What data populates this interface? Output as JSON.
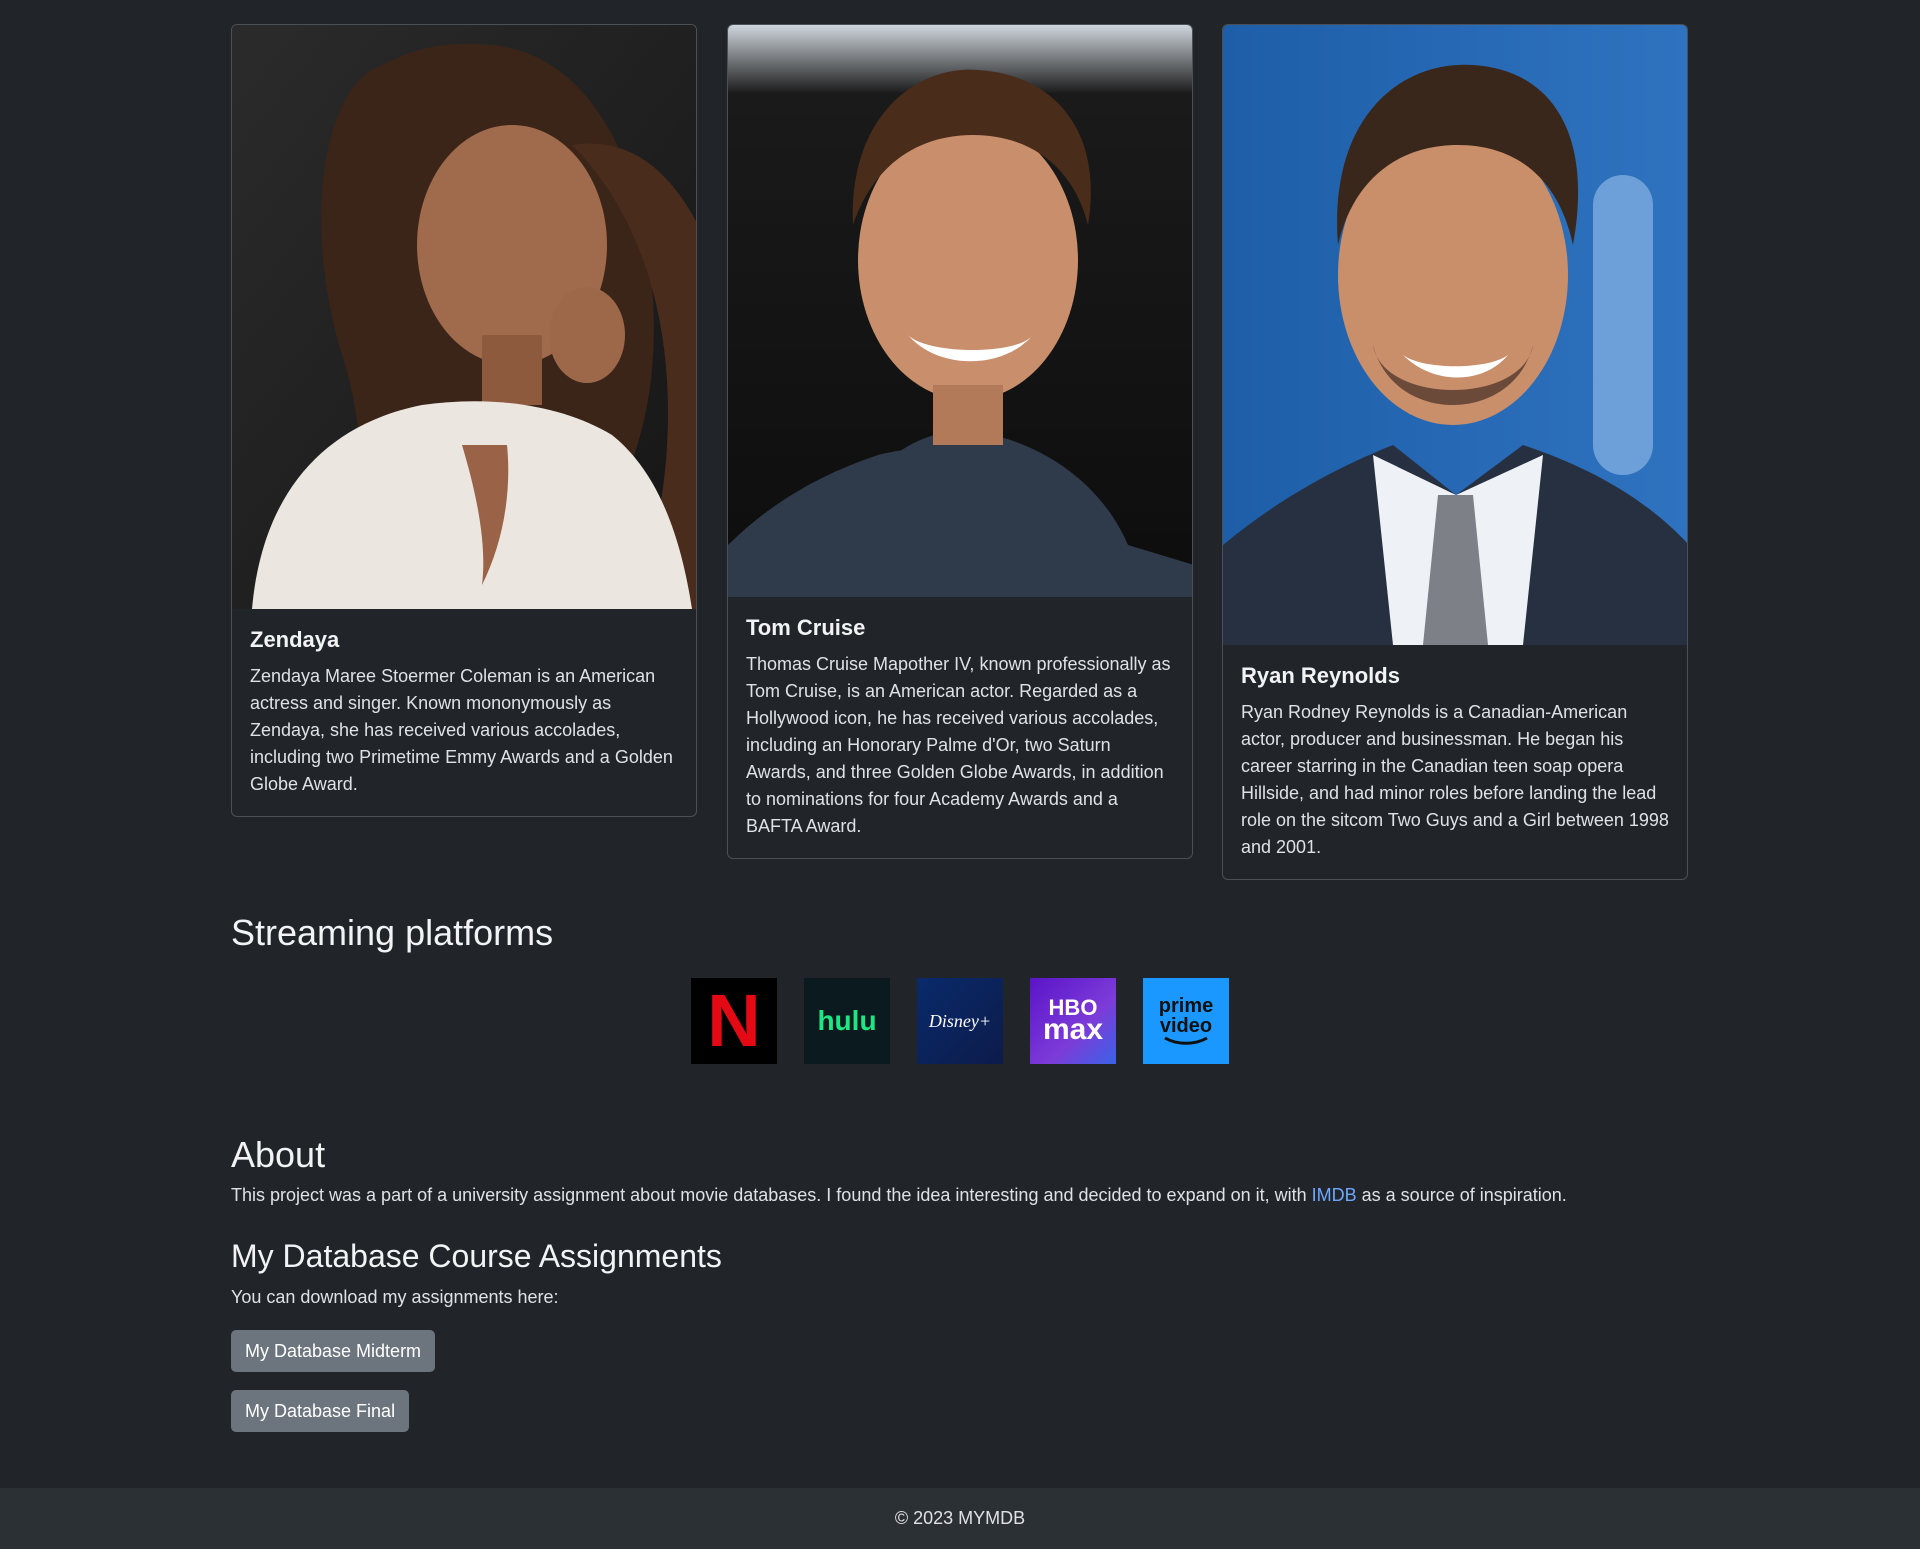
{
  "actors": [
    {
      "name": "Zendaya",
      "bio": "Zendaya Maree Stoermer Coleman is an American actress and singer. Known mononymously as Zendaya, she has received various accolades, including two Primetime Emmy Awards and a Golden Globe Award."
    },
    {
      "name": "Tom Cruise",
      "bio": "Thomas Cruise Mapother IV, known professionally as Tom Cruise, is an American actor. Regarded as a Hollywood icon, he has received various accolades, including an Honorary Palme d'Or, two Saturn Awards, and three Golden Globe Awards, in addition to nominations for four Academy Awards and a BAFTA Award."
    },
    {
      "name": "Ryan Reynolds",
      "bio": "Ryan Rodney Reynolds is a Canadian-American actor, producer and businessman. He began his career starring in the Canadian teen soap opera Hillside, and had minor roles before landing the lead role on the sitcom Two Guys and a Girl between 1998 and 2001."
    }
  ],
  "streaming": {
    "heading": "Streaming platforms",
    "platforms": [
      {
        "name": "Netflix",
        "logo_text": "N",
        "bg": "#000000",
        "fg": "#e50914"
      },
      {
        "name": "Hulu",
        "logo_text": "hulu",
        "bg": "#0b1a1e",
        "fg": "#1ce783"
      },
      {
        "name": "Disney+",
        "logo_text": "Disney+",
        "bg": "#0a2a6b",
        "fg": "#ffffff"
      },
      {
        "name": "HBO Max",
        "logo_text_top": "HBO",
        "logo_text_bottom": "max",
        "bg": "#6a1fd1",
        "fg": "#ffffff"
      },
      {
        "name": "Prime Video",
        "logo_text_top": "prime",
        "logo_text_bottom": "video",
        "bg": "#1a98ff",
        "fg": "#0f1111"
      }
    ]
  },
  "about": {
    "heading": "About",
    "text_before": "This project was a part of a university assignment about movie databases. I found the idea interesting and decided to expand on it, with ",
    "link_text": "IMDB",
    "text_after": " as a source of inspiration."
  },
  "assignments": {
    "heading": "My Database Course Assignments",
    "intro": "You can download my assignments here:",
    "midterm_label": "My Database Midterm",
    "final_label": "My Database Final"
  },
  "footer": {
    "text": "© 2023 MYMDB"
  }
}
